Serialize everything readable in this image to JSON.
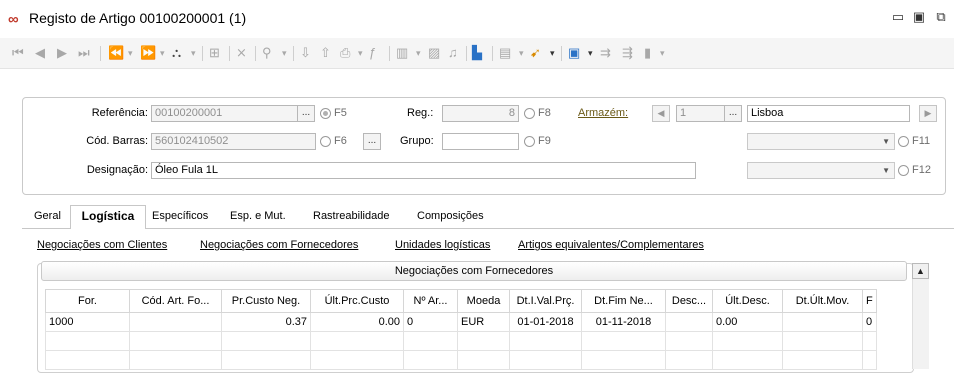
{
  "window": {
    "title": "Registo de Artigo 00100200001 (1)",
    "minimize": "▭",
    "maximize": "▣",
    "restore": "⧉"
  },
  "header": {
    "ref_label": "Referência:",
    "ref_value": "00100200001",
    "f5": "F5",
    "reg_label": "Reg.:",
    "reg_value": "8",
    "f8": "F8",
    "armazem_label": "Armazém:",
    "armazem_code": "1",
    "armazem_name": "Lisboa",
    "barcode_label": "Cód. Barras:",
    "barcode_value": "560102410502",
    "f6": "F6",
    "grupo_label": "Grupo:",
    "grupo_value": "",
    "f9": "F9",
    "f11": "F11",
    "designacao_label": "Designação:",
    "designacao_value": "Óleo Fula 1L",
    "f12": "F12",
    "ellipsis": "..."
  },
  "tabs": [
    {
      "label": "Geral"
    },
    {
      "label": "Logística"
    },
    {
      "label": "Específicos"
    },
    {
      "label": "Esp. e Mut."
    },
    {
      "label": "Rastreabilidade"
    },
    {
      "label": "Composições"
    }
  ],
  "sublinks": [
    {
      "label": "Negociações com Clientes"
    },
    {
      "label": "Negociações com Fornecedores"
    },
    {
      "label": "Unidades logísticas"
    },
    {
      "label": "Artigos equivalentes/Complementares"
    }
  ],
  "panel": {
    "title": "Negociações com Fornecedores"
  },
  "grid": {
    "columns": [
      "For.",
      "Cód. Art. Fo...",
      "Pr.Custo Neg.",
      "Últ.Prc.Custo",
      "Nº Ar...",
      "Moeda",
      "Dt.I.Val.Prç.",
      "Dt.Fim Ne...",
      "Desc...",
      "Últ.Desc.",
      "Dt.Últ.Mov.",
      "F"
    ],
    "rows": [
      [
        "1000",
        "",
        "0.37",
        "0.00",
        "0",
        "EUR",
        "01-01-2018",
        "01-11-2018",
        "",
        "0.00",
        "",
        "0"
      ]
    ]
  }
}
